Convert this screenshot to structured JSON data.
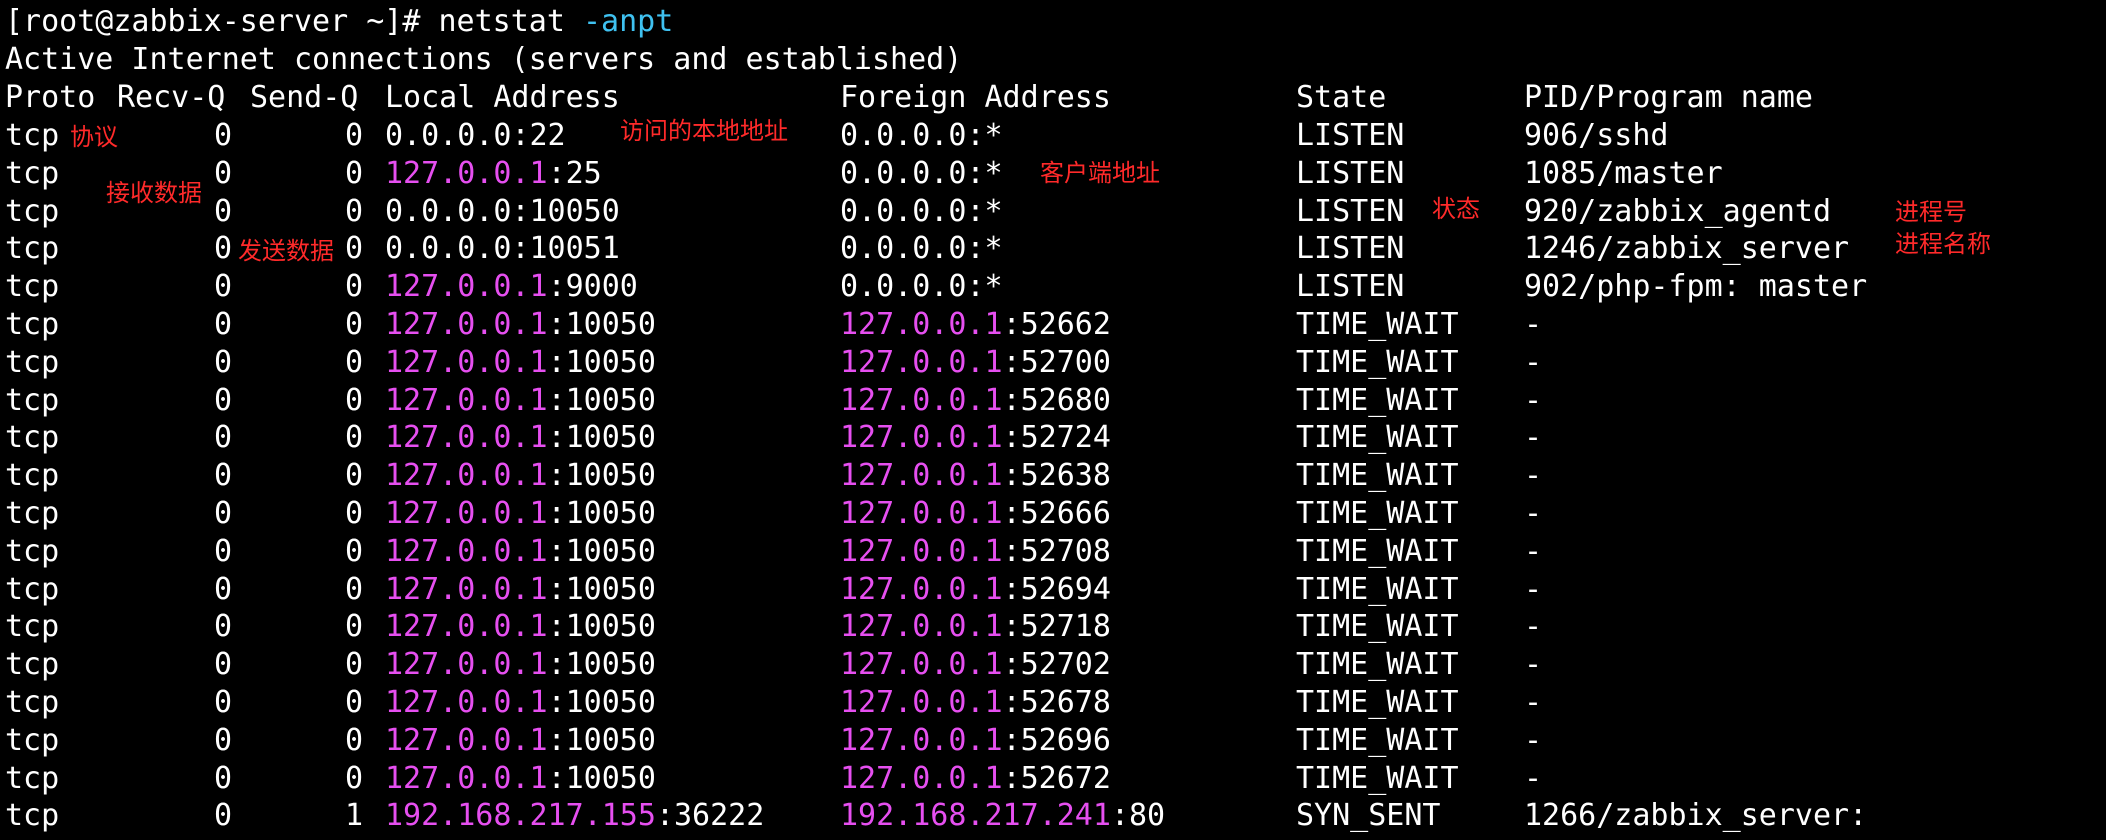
{
  "terminal": {
    "prompt": "[root@zabbix-server ~]# ",
    "command": "netstat",
    "command_args": " -anpt",
    "heading": "Active Internet connections (servers and established)",
    "columns": {
      "proto": "Proto",
      "recv_q": "Recv-Q",
      "send_q": "Send-Q",
      "local": "Local Address",
      "foreign": "Foreign Address",
      "state": "State",
      "program": "PID/Program name"
    },
    "rows": [
      {
        "proto": "tcp",
        "recv_q": "0",
        "send_q": "0",
        "local_ip": "0.0.0.0",
        "local_port": ":22",
        "local_ip_highlight": false,
        "foreign_ip": "0.0.0.0",
        "foreign_port": ":*",
        "foreign_ip_highlight": false,
        "state": "LISTEN",
        "program": "906/sshd"
      },
      {
        "proto": "tcp",
        "recv_q": "0",
        "send_q": "0",
        "local_ip": "127.0.0.1",
        "local_port": ":25",
        "local_ip_highlight": true,
        "foreign_ip": "0.0.0.0",
        "foreign_port": ":*",
        "foreign_ip_highlight": false,
        "state": "LISTEN",
        "program": "1085/master"
      },
      {
        "proto": "tcp",
        "recv_q": "0",
        "send_q": "0",
        "local_ip": "0.0.0.0",
        "local_port": ":10050",
        "local_ip_highlight": false,
        "foreign_ip": "0.0.0.0",
        "foreign_port": ":*",
        "foreign_ip_highlight": false,
        "state": "LISTEN",
        "program": "920/zabbix_agentd"
      },
      {
        "proto": "tcp",
        "recv_q": "0",
        "send_q": "0",
        "local_ip": "0.0.0.0",
        "local_port": ":10051",
        "local_ip_highlight": false,
        "foreign_ip": "0.0.0.0",
        "foreign_port": ":*",
        "foreign_ip_highlight": false,
        "state": "LISTEN",
        "program": "1246/zabbix_server"
      },
      {
        "proto": "tcp",
        "recv_q": "0",
        "send_q": "0",
        "local_ip": "127.0.0.1",
        "local_port": ":9000",
        "local_ip_highlight": true,
        "foreign_ip": "0.0.0.0",
        "foreign_port": ":*",
        "foreign_ip_highlight": false,
        "state": "LISTEN",
        "program": "902/php-fpm: master"
      },
      {
        "proto": "tcp",
        "recv_q": "0",
        "send_q": "0",
        "local_ip": "127.0.0.1",
        "local_port": ":10050",
        "local_ip_highlight": true,
        "foreign_ip": "127.0.0.1",
        "foreign_port": ":52662",
        "foreign_ip_highlight": true,
        "state": "TIME_WAIT",
        "program": "-"
      },
      {
        "proto": "tcp",
        "recv_q": "0",
        "send_q": "0",
        "local_ip": "127.0.0.1",
        "local_port": ":10050",
        "local_ip_highlight": true,
        "foreign_ip": "127.0.0.1",
        "foreign_port": ":52700",
        "foreign_ip_highlight": true,
        "state": "TIME_WAIT",
        "program": "-"
      },
      {
        "proto": "tcp",
        "recv_q": "0",
        "send_q": "0",
        "local_ip": "127.0.0.1",
        "local_port": ":10050",
        "local_ip_highlight": true,
        "foreign_ip": "127.0.0.1",
        "foreign_port": ":52680",
        "foreign_ip_highlight": true,
        "state": "TIME_WAIT",
        "program": "-"
      },
      {
        "proto": "tcp",
        "recv_q": "0",
        "send_q": "0",
        "local_ip": "127.0.0.1",
        "local_port": ":10050",
        "local_ip_highlight": true,
        "foreign_ip": "127.0.0.1",
        "foreign_port": ":52724",
        "foreign_ip_highlight": true,
        "state": "TIME_WAIT",
        "program": "-"
      },
      {
        "proto": "tcp",
        "recv_q": "0",
        "send_q": "0",
        "local_ip": "127.0.0.1",
        "local_port": ":10050",
        "local_ip_highlight": true,
        "foreign_ip": "127.0.0.1",
        "foreign_port": ":52638",
        "foreign_ip_highlight": true,
        "state": "TIME_WAIT",
        "program": "-"
      },
      {
        "proto": "tcp",
        "recv_q": "0",
        "send_q": "0",
        "local_ip": "127.0.0.1",
        "local_port": ":10050",
        "local_ip_highlight": true,
        "foreign_ip": "127.0.0.1",
        "foreign_port": ":52666",
        "foreign_ip_highlight": true,
        "state": "TIME_WAIT",
        "program": "-"
      },
      {
        "proto": "tcp",
        "recv_q": "0",
        "send_q": "0",
        "local_ip": "127.0.0.1",
        "local_port": ":10050",
        "local_ip_highlight": true,
        "foreign_ip": "127.0.0.1",
        "foreign_port": ":52708",
        "foreign_ip_highlight": true,
        "state": "TIME_WAIT",
        "program": "-"
      },
      {
        "proto": "tcp",
        "recv_q": "0",
        "send_q": "0",
        "local_ip": "127.0.0.1",
        "local_port": ":10050",
        "local_ip_highlight": true,
        "foreign_ip": "127.0.0.1",
        "foreign_port": ":52694",
        "foreign_ip_highlight": true,
        "state": "TIME_WAIT",
        "program": "-"
      },
      {
        "proto": "tcp",
        "recv_q": "0",
        "send_q": "0",
        "local_ip": "127.0.0.1",
        "local_port": ":10050",
        "local_ip_highlight": true,
        "foreign_ip": "127.0.0.1",
        "foreign_port": ":52718",
        "foreign_ip_highlight": true,
        "state": "TIME_WAIT",
        "program": "-"
      },
      {
        "proto": "tcp",
        "recv_q": "0",
        "send_q": "0",
        "local_ip": "127.0.0.1",
        "local_port": ":10050",
        "local_ip_highlight": true,
        "foreign_ip": "127.0.0.1",
        "foreign_port": ":52702",
        "foreign_ip_highlight": true,
        "state": "TIME_WAIT",
        "program": "-"
      },
      {
        "proto": "tcp",
        "recv_q": "0",
        "send_q": "0",
        "local_ip": "127.0.0.1",
        "local_port": ":10050",
        "local_ip_highlight": true,
        "foreign_ip": "127.0.0.1",
        "foreign_port": ":52678",
        "foreign_ip_highlight": true,
        "state": "TIME_WAIT",
        "program": "-"
      },
      {
        "proto": "tcp",
        "recv_q": "0",
        "send_q": "0",
        "local_ip": "127.0.0.1",
        "local_port": ":10050",
        "local_ip_highlight": true,
        "foreign_ip": "127.0.0.1",
        "foreign_port": ":52696",
        "foreign_ip_highlight": true,
        "state": "TIME_WAIT",
        "program": "-"
      },
      {
        "proto": "tcp",
        "recv_q": "0",
        "send_q": "0",
        "local_ip": "127.0.0.1",
        "local_port": ":10050",
        "local_ip_highlight": true,
        "foreign_ip": "127.0.0.1",
        "foreign_port": ":52672",
        "foreign_ip_highlight": true,
        "state": "TIME_WAIT",
        "program": "-"
      },
      {
        "proto": "tcp",
        "recv_q": "0",
        "send_q": "1",
        "local_ip": "192.168.217.155",
        "local_port": ":36222",
        "local_ip_highlight": true,
        "foreign_ip": "192.168.217.241",
        "foreign_port": ":80",
        "foreign_ip_highlight": true,
        "state": "SYN_SENT",
        "program": "1266/zabbix_server:"
      }
    ],
    "annotations": {
      "protocol": "协议",
      "local_address": "访问的本地地址",
      "recv_data": "接收数据",
      "client_address": "客户端地址",
      "state": "状态",
      "pid": "进程号",
      "send_data": "发送数据",
      "program_name": "进程名称"
    },
    "colors": {
      "background": "#000000",
      "text": "#ffffff",
      "ip_highlight": "#e64ff0",
      "command_flag": "#3fc1f0",
      "annotation": "#ff2a2a"
    }
  }
}
